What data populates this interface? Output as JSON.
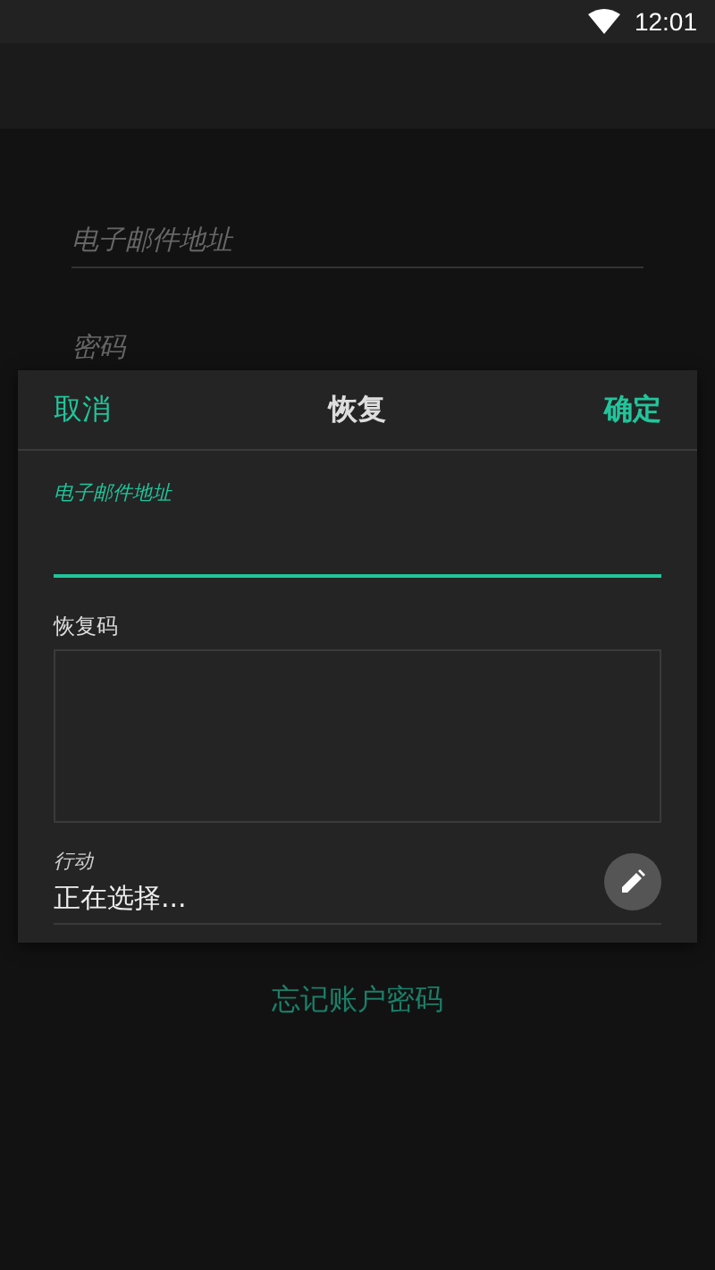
{
  "status_bar": {
    "time": "12:01"
  },
  "login_form": {
    "email_placeholder": "电子邮件地址",
    "password_placeholder": "密码",
    "forgot_link": "忘记账户密码"
  },
  "dialog": {
    "cancel": "取消",
    "title": "恢复",
    "confirm": "确定",
    "email": {
      "label": "电子邮件地址",
      "focused": true
    },
    "recovery_code": {
      "label": "恢复码"
    },
    "action": {
      "label": "行动",
      "value": "正在选择..."
    }
  }
}
